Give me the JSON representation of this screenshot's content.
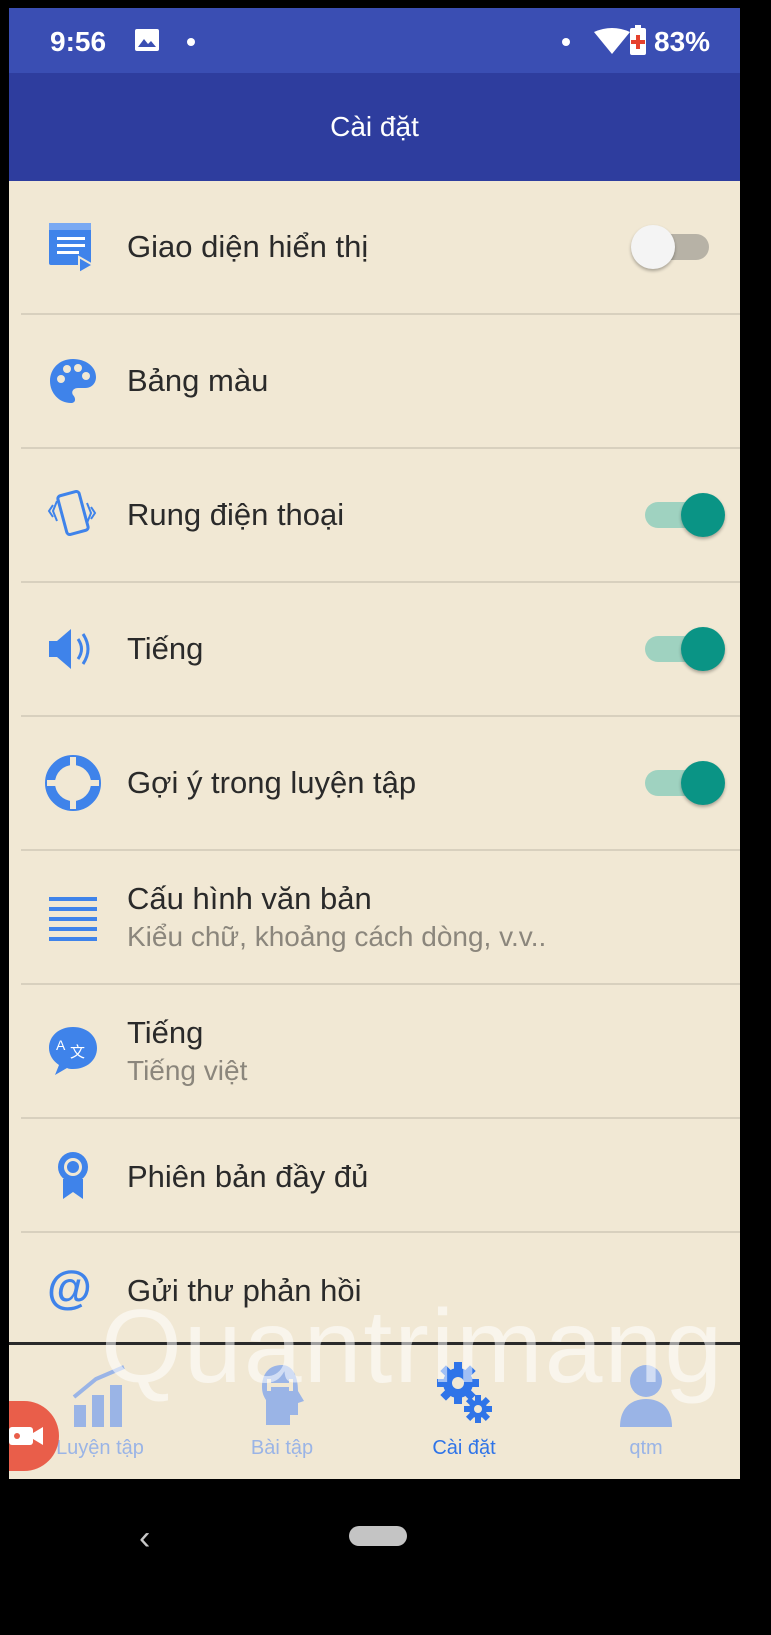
{
  "status_bar": {
    "time": "9:56",
    "battery": "83%"
  },
  "app_bar": {
    "title": "Cài đặt"
  },
  "settings": [
    {
      "label": "Giao diện hiển thị",
      "sublabel": "",
      "icon": "display-mode-icon",
      "toggle": "off"
    },
    {
      "label": "Bảng màu",
      "sublabel": "",
      "icon": "palette-icon",
      "toggle": null
    },
    {
      "label": "Rung điện thoại",
      "sublabel": "",
      "icon": "phone-vibrate-icon",
      "toggle": "on"
    },
    {
      "label": "Tiếng",
      "sublabel": "",
      "icon": "speaker-icon",
      "toggle": "on"
    },
    {
      "label": "Gợi ý trong luyện tập",
      "sublabel": "",
      "icon": "lifebuoy-icon",
      "toggle": "on"
    },
    {
      "label": "Cấu hình văn bản",
      "sublabel": "Kiểu chữ, khoảng cách dòng, v.v..",
      "icon": "text-lines-icon",
      "toggle": null
    },
    {
      "label": "Tiếng",
      "sublabel": "Tiếng việt",
      "icon": "translate-icon",
      "toggle": null
    },
    {
      "label": "Phiên bản đầy đủ",
      "sublabel": "",
      "icon": "award-badge-icon",
      "toggle": null
    },
    {
      "label": "Gửi thư phản hồi",
      "sublabel": "",
      "icon": "at-sign-icon",
      "toggle": null
    }
  ],
  "bottom_nav": [
    {
      "label": "Luyện tập",
      "icon": "bar-chart-icon",
      "active": false
    },
    {
      "label": "Bài tập",
      "icon": "head-brain-icon",
      "active": false
    },
    {
      "label": "Cài đặt",
      "icon": "gears-icon",
      "active": true
    },
    {
      "label": "qtm",
      "icon": "user-icon",
      "active": false
    }
  ],
  "watermark": "Quantrimang",
  "colors": {
    "accent": "#2f74e8",
    "appbar": "#2e3d9e",
    "statusbar": "#3a4eb3",
    "background": "#f1e8d4",
    "toggle_on": "#0a9485"
  }
}
